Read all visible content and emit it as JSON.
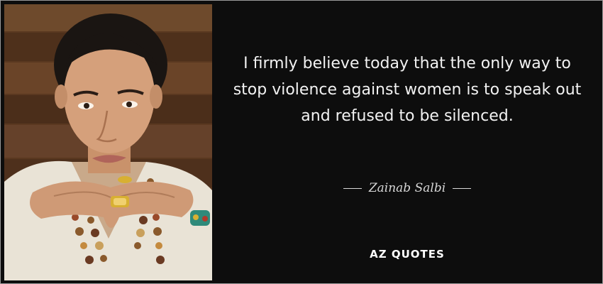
{
  "quote": {
    "text": "I firmly believe today that the only way to stop violence against women is to speak out and refused to be silenced.",
    "author": "Zainab Salbi"
  },
  "brand": {
    "logo_text": "AZ QUOTES"
  },
  "colors": {
    "background": "#0d0d0d",
    "text": "#f2f2f2",
    "author": "#d8d8d8"
  }
}
